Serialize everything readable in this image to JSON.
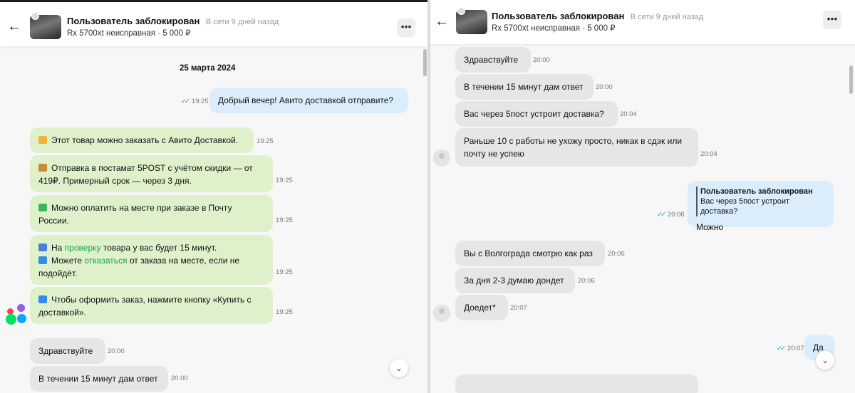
{
  "header": {
    "title": "Пользователь заблокирован",
    "status": "В сети 9 дней назад",
    "subtitle": "Rx 5700xt неисправная · 5 000 ₽",
    "back_icon": "arrow-left-icon",
    "menu_label": "•••"
  },
  "left": {
    "date": "25 марта 2024",
    "my_message": {
      "time": "19:25",
      "text": "Добрый вечер! Авито доставкой отправите?",
      "checks": "✓✓"
    },
    "system_messages": [
      {
        "icon": "truck-icon",
        "text": "Этот товар можно заказать с Авито Доставкой.",
        "time": "19:25"
      },
      {
        "icon": "package-icon",
        "text": "Отправка в постамат 5POST с учётом скидки — от 419₽. Примерный срок — через 3 дня.",
        "time": "19:25"
      },
      {
        "icon": "money-icon",
        "text": "Можно оплатить на месте при заказе в Почту России.",
        "time": "19:25"
      },
      {
        "icon": "magnifier-icon",
        "line1_pre": "На",
        "line1_link": "проверку",
        "line1_post": "товара у вас будет 15 минут.",
        "line2_icon": "return-icon",
        "line2_pre": "Можете",
        "line2_link": "отказаться",
        "line2_post": "от заказа на месте, если не подойдёт.",
        "time": "19:25"
      },
      {
        "icon": "arrow-down-icon",
        "text": "Чтобы оформить заказ, нажмите кнопку «Купить с доставкой».",
        "time": "19:25"
      }
    ],
    "incoming": [
      {
        "text": "Здравствуйте",
        "time": "20:00"
      },
      {
        "text": "В течении 15 минут дам ответ",
        "time": "20:00"
      }
    ]
  },
  "right": {
    "incoming_top": [
      {
        "text": "Здравствуйте",
        "time": "20:00"
      },
      {
        "text": "В течении 15 минут дам ответ",
        "time": "20:00"
      },
      {
        "text": "Вас через 5пост устроит доставка?",
        "time": "20:04"
      },
      {
        "text": "Раньше 10 с работы не ухожу просто, никак в сдэк или почту не успею",
        "time": "20:04"
      }
    ],
    "reply": {
      "quote_name": "Пользователь заблокирован",
      "quote_text": "Вас через 5пост устроит доставка?",
      "text": "Можно",
      "time": "20:06",
      "checks": "✓✓"
    },
    "incoming_bottom": [
      {
        "text": "Вы с Волгограда смотрю как раз",
        "time": "20:06"
      },
      {
        "text": "За дня 2-3 думаю дондет",
        "time": "20:06"
      },
      {
        "text": "Доедет*",
        "time": "20:07"
      }
    ],
    "last_my": {
      "text": "Да",
      "time": "20:07",
      "checks": "✓✓"
    }
  },
  "colors": {
    "green_bubble": "#def1cb",
    "grey_bubble": "#e6e6e6",
    "blue_bubble": "#dbedfb",
    "link": "#13a546",
    "check": "#3a8fe0"
  }
}
